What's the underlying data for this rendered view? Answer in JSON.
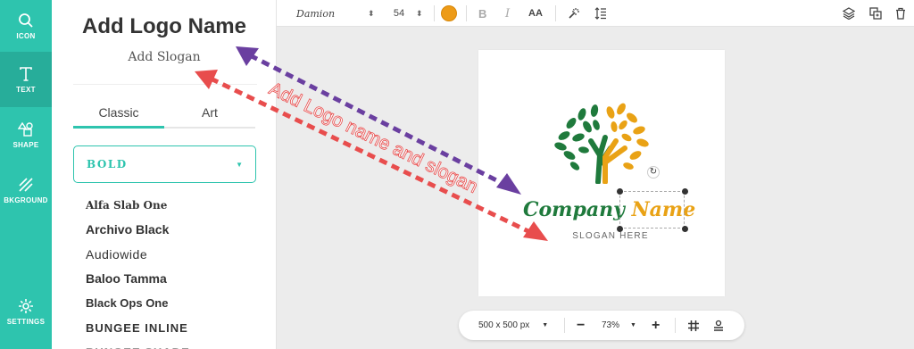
{
  "rail": {
    "items": [
      {
        "label": "ICON",
        "icon": "search-icon"
      },
      {
        "label": "TEXT",
        "icon": "text-icon"
      },
      {
        "label": "SHAPE",
        "icon": "shapes-icon"
      },
      {
        "label": "BKGROUND",
        "icon": "background-icon"
      },
      {
        "label": "SETTINGS",
        "icon": "gear-icon"
      }
    ]
  },
  "panel": {
    "logo_name": "Add Logo Name",
    "slogan": "Add Slogan",
    "tabs": [
      "Classic",
      "Art"
    ],
    "font_category": "BOLD",
    "fonts": [
      "Alfa Slab One",
      "Archivo Black",
      "Audiowide",
      "Baloo Tamma",
      "Black Ops One",
      "BUNGEE INLINE",
      "BUNGEE SHADE"
    ]
  },
  "toolbar": {
    "font_name": "Damion",
    "font_size": "54",
    "text_color": "#ed9b18",
    "bold": "B",
    "italic": "I",
    "case": "AA"
  },
  "canvas": {
    "company": "Company",
    "name": "Name",
    "slogan": "SLOGAN HERE"
  },
  "zoom": {
    "size": "500 x 500 px",
    "minus": "−",
    "percent": "73%",
    "plus": "+"
  },
  "annotation": {
    "text": "Add Logo name and slogan",
    "colors": {
      "purple": "#6a3fa0",
      "red": "#e84d4d"
    }
  },
  "colors": {
    "accent": "#2ec4ae",
    "logo_green": "#1f7a3c",
    "logo_orange": "#e9a215"
  }
}
